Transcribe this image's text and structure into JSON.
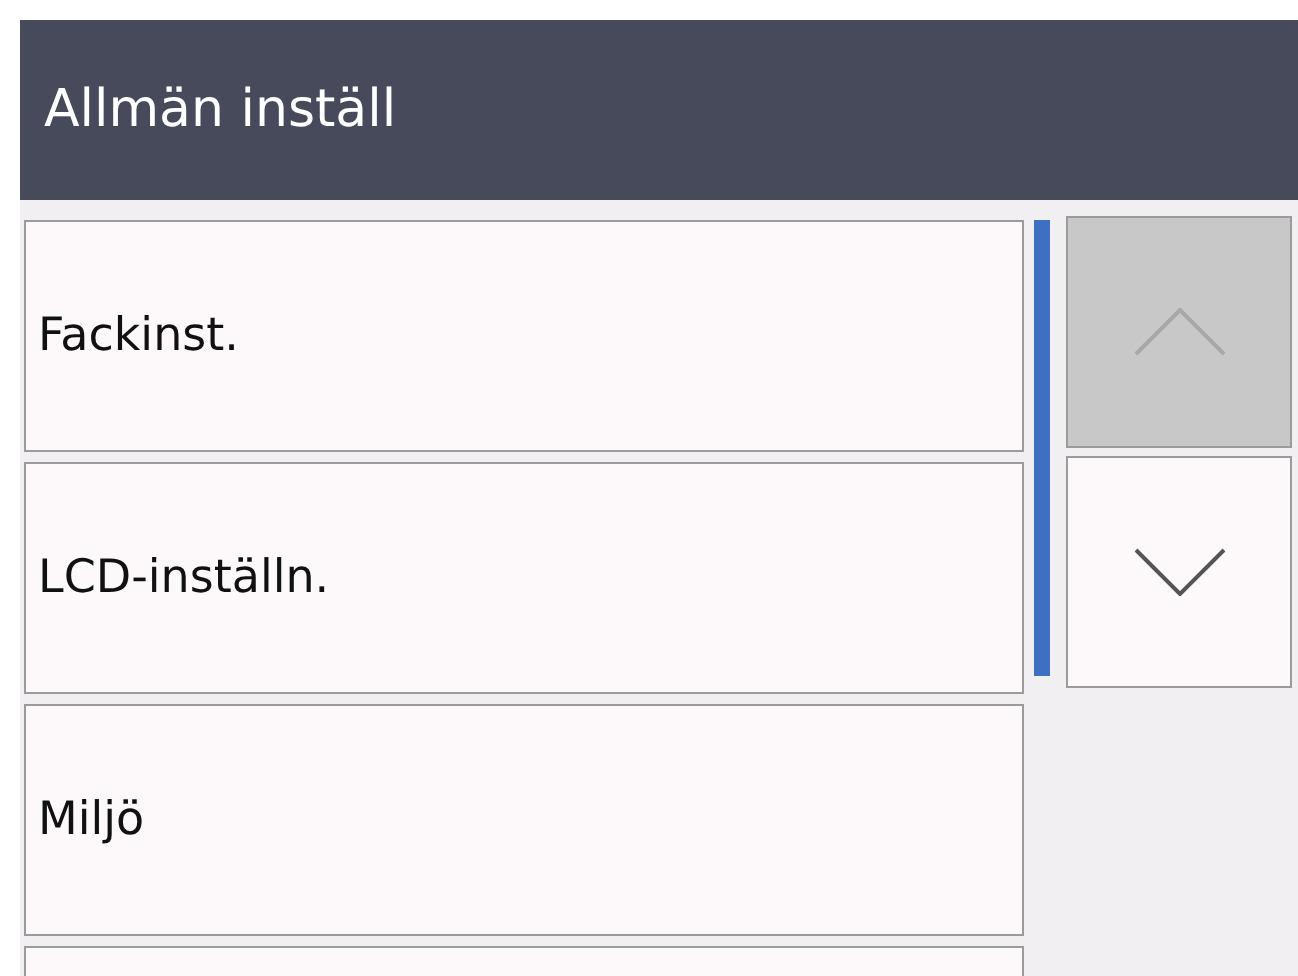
{
  "header": {
    "title": "Allmän inställ"
  },
  "items": [
    {
      "label": "Fackinst."
    },
    {
      "label": "LCD-inställn."
    },
    {
      "label": "Miljö"
    }
  ],
  "more_items_below": true,
  "scroll_buttons": {
    "up_disabled": true,
    "down_disabled": false
  }
}
